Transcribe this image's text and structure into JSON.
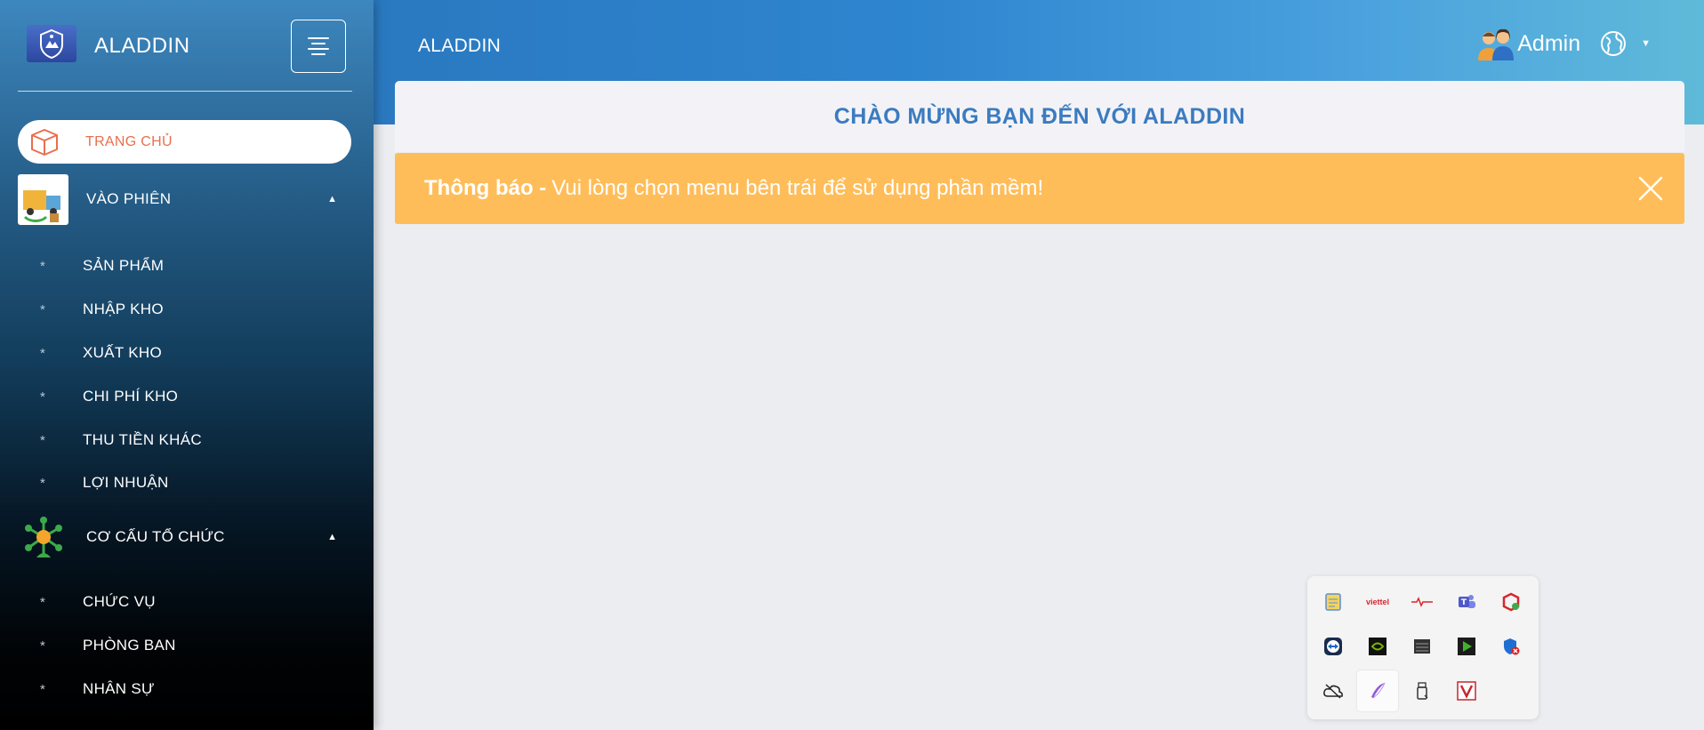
{
  "app": {
    "name": "ALADDIN"
  },
  "header": {
    "title": "ALADDIN",
    "user_name": "Admin"
  },
  "sidebar": {
    "active_item": {
      "label": "TRANG CHỦ"
    },
    "groups": [
      {
        "label": "VÀO PHIÊN",
        "items": [
          "SẢN PHẨM",
          "NHẬP KHO",
          "XUẤT KHO",
          "CHI PHÍ KHO",
          "THU TIỀN KHÁC",
          "LỢI NHUẬN"
        ]
      },
      {
        "label": "CƠ CẤU TỔ CHỨC",
        "items": [
          "CHỨC VỤ",
          "PHÒNG BAN",
          "NHÂN SỰ"
        ]
      }
    ],
    "bullet": "*",
    "caret": "▲"
  },
  "main": {
    "welcome": "CHÀO MỪNG BẠN ĐẾN VỚI ALADDIN",
    "alert": {
      "title": "Thông báo -",
      "message": "Vui lòng chọn menu bên trái để sử dụng phần mềm!"
    }
  },
  "tray": {
    "viettel_label": "viettel",
    "icons": [
      "notes-icon",
      "viettel-icon",
      "signal-icon",
      "teams-icon",
      "security-icon",
      "teamviewer-icon",
      "nvidia-icon",
      "storage-icon",
      "media-icon",
      "defender-icon",
      "onedrive-icon",
      "pen-icon",
      "usb-icon",
      "v-icon"
    ]
  },
  "colors": {
    "accent": "#e96f4e",
    "alert": "#ffbd59",
    "welcome_text": "#3b7bc0"
  }
}
